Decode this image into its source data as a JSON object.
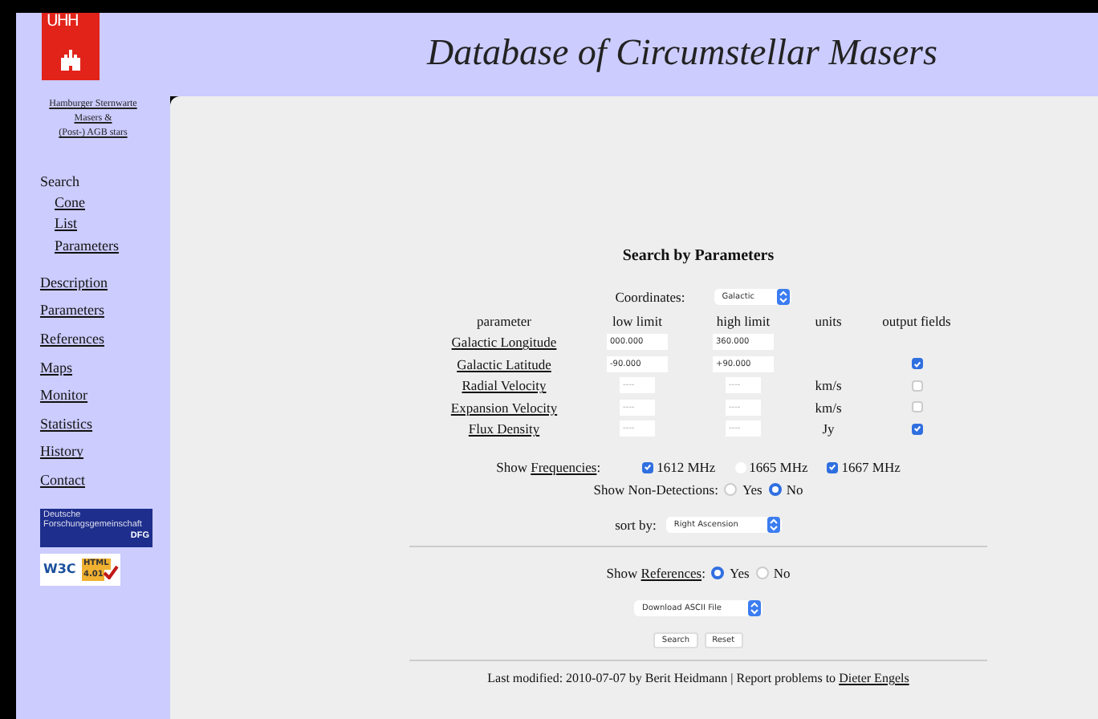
{
  "header": {
    "logo_text": "UHH",
    "title": "Database of Circumstellar Masers"
  },
  "sidebar": {
    "institute": [
      {
        "text": "Hamburger Sternwarte"
      },
      {
        "text": "Masers &"
      },
      {
        "text": "(Post-) AGB stars"
      }
    ],
    "nav": [
      {
        "label": "Search",
        "link": false,
        "children": [
          {
            "label": "Cone",
            "link": true
          },
          {
            "label": "List",
            "link": true
          },
          {
            "label": "Parameters",
            "link": true
          }
        ]
      },
      {
        "label": "Description",
        "link": true
      },
      {
        "label": "Parameters",
        "link": true
      },
      {
        "label": "References",
        "link": true
      },
      {
        "label": "Maps",
        "link": true
      },
      {
        "label": "Monitor",
        "link": true
      },
      {
        "label": "Statistics",
        "link": true
      },
      {
        "label": "History",
        "link": true
      },
      {
        "label": "Contact",
        "link": true
      }
    ],
    "badges": [
      {
        "kind": "dfg",
        "lines": [
          "Deutsche",
          "Forschungsgemeinschaft",
          "DFG"
        ]
      },
      {
        "kind": "w3c",
        "lines": [
          "W3C",
          "HTML",
          "4.01"
        ]
      }
    ]
  },
  "form": {
    "heading": "Search by Parameters",
    "coordinates": {
      "label": "Coordinates:",
      "value": "Galactic"
    },
    "columns": [
      "parameter",
      "low limit",
      "high limit",
      "units",
      "output fields"
    ],
    "rows": [
      {
        "name": "Galactic Longitude",
        "kind": "wide",
        "low": "000.000",
        "high": "360.000"
      },
      {
        "name": "Galactic Latitude",
        "kind": "wide",
        "low": "-90.000",
        "high": "+90.000",
        "output": true
      },
      {
        "name": "Radial Velocity",
        "kind": "narrow",
        "low": "----",
        "high": "----",
        "units": "km/s",
        "output": false
      },
      {
        "name": "Expansion Velocity",
        "kind": "narrow",
        "low": "----",
        "high": "----",
        "units": "km/s",
        "output": false
      },
      {
        "name": "Flux Density",
        "kind": "narrow",
        "low": "----",
        "high": "----",
        "units": "Jy",
        "output": true
      }
    ],
    "frequencies": {
      "label": {
        "before": "Show ",
        "link": "Frequencies",
        "after": ":"
      },
      "options": [
        {
          "label": "1612 MHz",
          "checked": true
        },
        {
          "label": "1665 MHz",
          "checked": false
        },
        {
          "label": "1667 MHz",
          "checked": true
        }
      ]
    },
    "non_detections": {
      "label": "Show Non-Detections:",
      "options": [
        {
          "label": "Yes",
          "selected": false
        },
        {
          "label": "No",
          "selected": true
        }
      ]
    },
    "sort": {
      "label": "sort by:",
      "value": "Right Ascension"
    },
    "references": {
      "label": {
        "before": "Show ",
        "link": "References",
        "after": ":"
      },
      "options": [
        {
          "label": "Yes",
          "selected": true
        },
        {
          "label": "No",
          "selected": false
        }
      ]
    },
    "download": {
      "value": "Download ASCII File"
    },
    "buttons": [
      "Search",
      "Reset"
    ],
    "footer": {
      "before": "Last modified: 2010-07-07 by Berit Heidmann | Report problems to ",
      "link": "Dieter Engels"
    }
  }
}
